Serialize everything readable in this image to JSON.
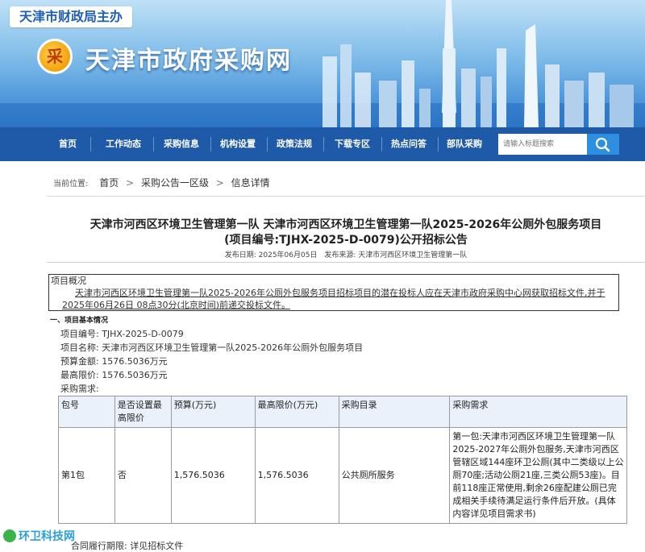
{
  "header": {
    "sponsor": "天津市财政局主办",
    "site_name": "天津市政府采购网",
    "logo_glyph": "采"
  },
  "nav": {
    "items": [
      "首页",
      "工作动态",
      "采购信息",
      "机构设置",
      "政策法规",
      "下载专区",
      "热点问答",
      "部队采购"
    ],
    "search_placeholder": "请输入标题搜索"
  },
  "breadcrumb": {
    "label": "当前位置:",
    "items": [
      "首页",
      "采购公告一区级",
      "信息详情"
    ]
  },
  "article": {
    "title_line1": "天津市河西区环境卫生管理第一队 天津市河西区环境卫生管理第一队2025-2026年公厕外包服务项目",
    "title_line2": "(项目编号:TJHX-2025-D-0079)公开招标公告",
    "publish_date": "发布日期: 2025年06月05日",
    "source": "发布来源: 天津市河西区环境卫生管理第一队",
    "overview_heading": "项目概况",
    "overview_text": "天津市河西区环境卫生管理第一队2025-2026年公厕外包服务项目招标项目的潜在投标人应在天津市政府采购中心网获取招标文件,并于2025年06月26日 08点30分(北京时间)前递交投标文件。",
    "section1_title": "一、项目基本情况",
    "project_no": "项目编号: TJHX-2025-D-0079",
    "project_name": "项目名称: 天津市河西区环境卫生管理第一队2025-2026年公厕外包服务项目",
    "budget": "预算金额: 1576.5036万元",
    "max_price": "最高限价: 1576.5036万元",
    "requirement_label": "采购需求:",
    "table": {
      "headers": [
        "包号",
        "是否设置最高限价",
        "预算(万元)",
        "最高限价(万元)",
        "采购目录",
        "采购需求"
      ],
      "rows": [
        [
          "第1包",
          "否",
          "1,576.5036",
          "1,576.5036",
          "公共厕所服务",
          "第一包:天津市河西区环境卫生管理第一队2025-2027年公厕外包服务,天津市河西区管辖区域144座环卫公厕(其中二类级以上公厕70座;活动公厕21座,三类公厕53座)。目前118座正常使用,剩余26座配建公厕已完成相关手续待满足运行条件后开放。(具体内容详见项目需求书)"
        ]
      ]
    },
    "cut_line": "合同履行期限: 详见招标文件"
  },
  "watermark": "环卫科技网"
}
